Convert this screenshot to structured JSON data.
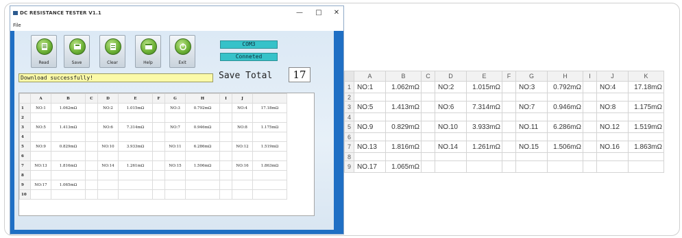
{
  "window": {
    "title": "DC RESISTANCE TESTER V1.1",
    "menu": [
      "File"
    ],
    "controls": [
      "—",
      "□",
      "✕"
    ]
  },
  "toolbar": [
    {
      "label": "Read",
      "icon": "read-icon"
    },
    {
      "label": "Save",
      "icon": "save-icon"
    },
    {
      "label": "Clear",
      "icon": "clear-icon"
    },
    {
      "label": "Help",
      "icon": "help-icon"
    },
    {
      "label": "Exit",
      "icon": "exit-icon"
    }
  ],
  "status": {
    "port": "COM3",
    "connection": "Conneted",
    "save_total_label": "Save Total",
    "save_total_value": "17",
    "message": "Download successfully!"
  },
  "app_grid": {
    "columns": [
      "",
      "A",
      "B",
      "C",
      "D",
      "E",
      "F",
      "G",
      "H",
      "I",
      "J"
    ],
    "rows": [
      [
        "1",
        "NO:1",
        "1.062mΩ",
        "",
        "NO:2",
        "1.015mΩ",
        "",
        "NO:3",
        "0.792mΩ",
        "",
        "NO:4",
        "17.18mΩ"
      ],
      [
        "2",
        "",
        "",
        "",
        "",
        "",
        "",
        "",
        "",
        "",
        "",
        ""
      ],
      [
        "3",
        "NO:5",
        "1.413mΩ",
        "",
        "NO:6",
        "7.314mΩ",
        "",
        "NO:7",
        "0.946mΩ",
        "",
        "NO:8",
        "1.175mΩ"
      ],
      [
        "4",
        "",
        "",
        "",
        "",
        "",
        "",
        "",
        "",
        "",
        "",
        ""
      ],
      [
        "5",
        "NO:9",
        "0.829mΩ",
        "",
        "NO:10",
        "3.933mΩ",
        "",
        "NO:11",
        "6.286mΩ",
        "",
        "NO:12",
        "1.519mΩ"
      ],
      [
        "6",
        "",
        "",
        "",
        "",
        "",
        "",
        "",
        "",
        "",
        "",
        ""
      ],
      [
        "7",
        "NO:13",
        "1.816mΩ",
        "",
        "NO:14",
        "1.261mΩ",
        "",
        "NO:15",
        "1.506mΩ",
        "",
        "NO:16",
        "1.863mΩ"
      ],
      [
        "8",
        "",
        "",
        "",
        "",
        "",
        "",
        "",
        "",
        "",
        "",
        ""
      ],
      [
        "9",
        "NO:17",
        "1.065mΩ",
        "",
        "",
        "",
        "",
        "",
        "",
        "",
        "",
        ""
      ],
      [
        "10",
        "",
        "",
        "",
        "",
        "",
        "",
        "",
        "",
        "",
        "",
        ""
      ]
    ]
  },
  "spreadsheet": {
    "columns": [
      "A",
      "B",
      "C",
      "D",
      "E",
      "F",
      "G",
      "H",
      "I",
      "J",
      "K"
    ],
    "rows": [
      [
        "1",
        "NO:1",
        "1.062mΩ",
        "",
        "NO:2",
        "1.015mΩ",
        "",
        "NO:3",
        "0.792mΩ",
        "",
        "NO:4",
        "17.18mΩ"
      ],
      [
        "2",
        "",
        "",
        "",
        "",
        "",
        "",
        "",
        "",
        "",
        "",
        ""
      ],
      [
        "3",
        "NO:5",
        "1.413mΩ",
        "",
        "NO:6",
        "7.314mΩ",
        "",
        "NO:7",
        "0.946mΩ",
        "",
        "NO:8",
        "1.175mΩ"
      ],
      [
        "4",
        "",
        "",
        "",
        "",
        "",
        "",
        "",
        "",
        "",
        "",
        ""
      ],
      [
        "5",
        "NO.9",
        "0.829mΩ",
        "",
        "NO.10",
        "3.933mΩ",
        "",
        "NO.11",
        "6.286mΩ",
        "",
        "NO.12",
        "1.519mΩ"
      ],
      [
        "6",
        "",
        "",
        "",
        "",
        "",
        "",
        "",
        "",
        "",
        "",
        ""
      ],
      [
        "7",
        "NO.13",
        "1.816mΩ",
        "",
        "NO.14",
        "1.261mΩ",
        "",
        "NO.15",
        "1.506mΩ",
        "",
        "NO.16",
        "1.863mΩ"
      ],
      [
        "8",
        "",
        "",
        "",
        "",
        "",
        "",
        "",
        "",
        "",
        "",
        ""
      ],
      [
        "9",
        "NO.17",
        "1.065mΩ",
        "",
        "",
        "",
        "",
        "",
        "",
        "",
        "",
        ""
      ]
    ]
  }
}
